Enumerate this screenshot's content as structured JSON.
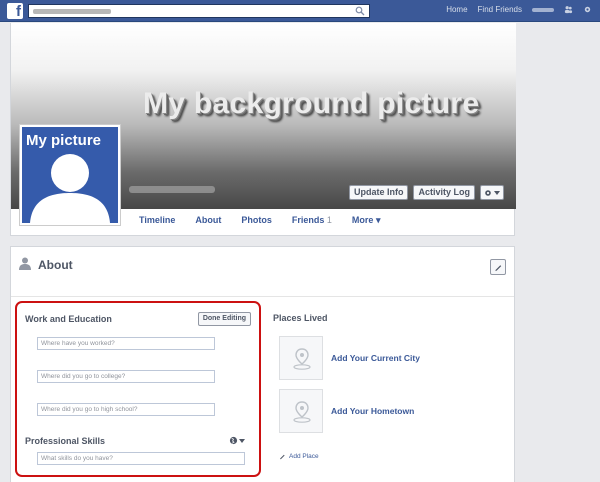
{
  "topbar": {
    "logo": "f",
    "search_placeholder": "",
    "links": [
      "Home",
      "Find Friends"
    ]
  },
  "profile": {
    "cover_title": "My background picture",
    "picture_label": "My picture",
    "buttons": {
      "update_info": "Update Info",
      "activity_log": "Activity Log"
    },
    "tabs": [
      "Timeline",
      "About",
      "Photos",
      "Friends",
      "More"
    ],
    "friends_suffix": "1",
    "more_suffix": "▾"
  },
  "about": {
    "title": "About",
    "work": {
      "title": "Work and Education",
      "done_label": "Done Editing",
      "fields": [
        {
          "placeholder": "Where have you worked?"
        },
        {
          "placeholder": "Where did you go to college?"
        },
        {
          "placeholder": "Where did you go to high school?"
        }
      ],
      "skills_title": "Professional Skills",
      "skills_placeholder": "What skills do you have?"
    },
    "places": {
      "title": "Places Lived",
      "items": [
        {
          "label": "Add Your Current City"
        },
        {
          "label": "Add Your Hometown"
        }
      ],
      "add_label": "Add Place"
    }
  },
  "colors": {
    "brand": "#3b5998",
    "highlight_border": "#cc1111",
    "profile_pic_bg": "#355bab"
  },
  "icons": [
    "search-icon",
    "gear-icon",
    "person-icon",
    "pencil-icon",
    "globe-icon",
    "map-pin-icon"
  ]
}
